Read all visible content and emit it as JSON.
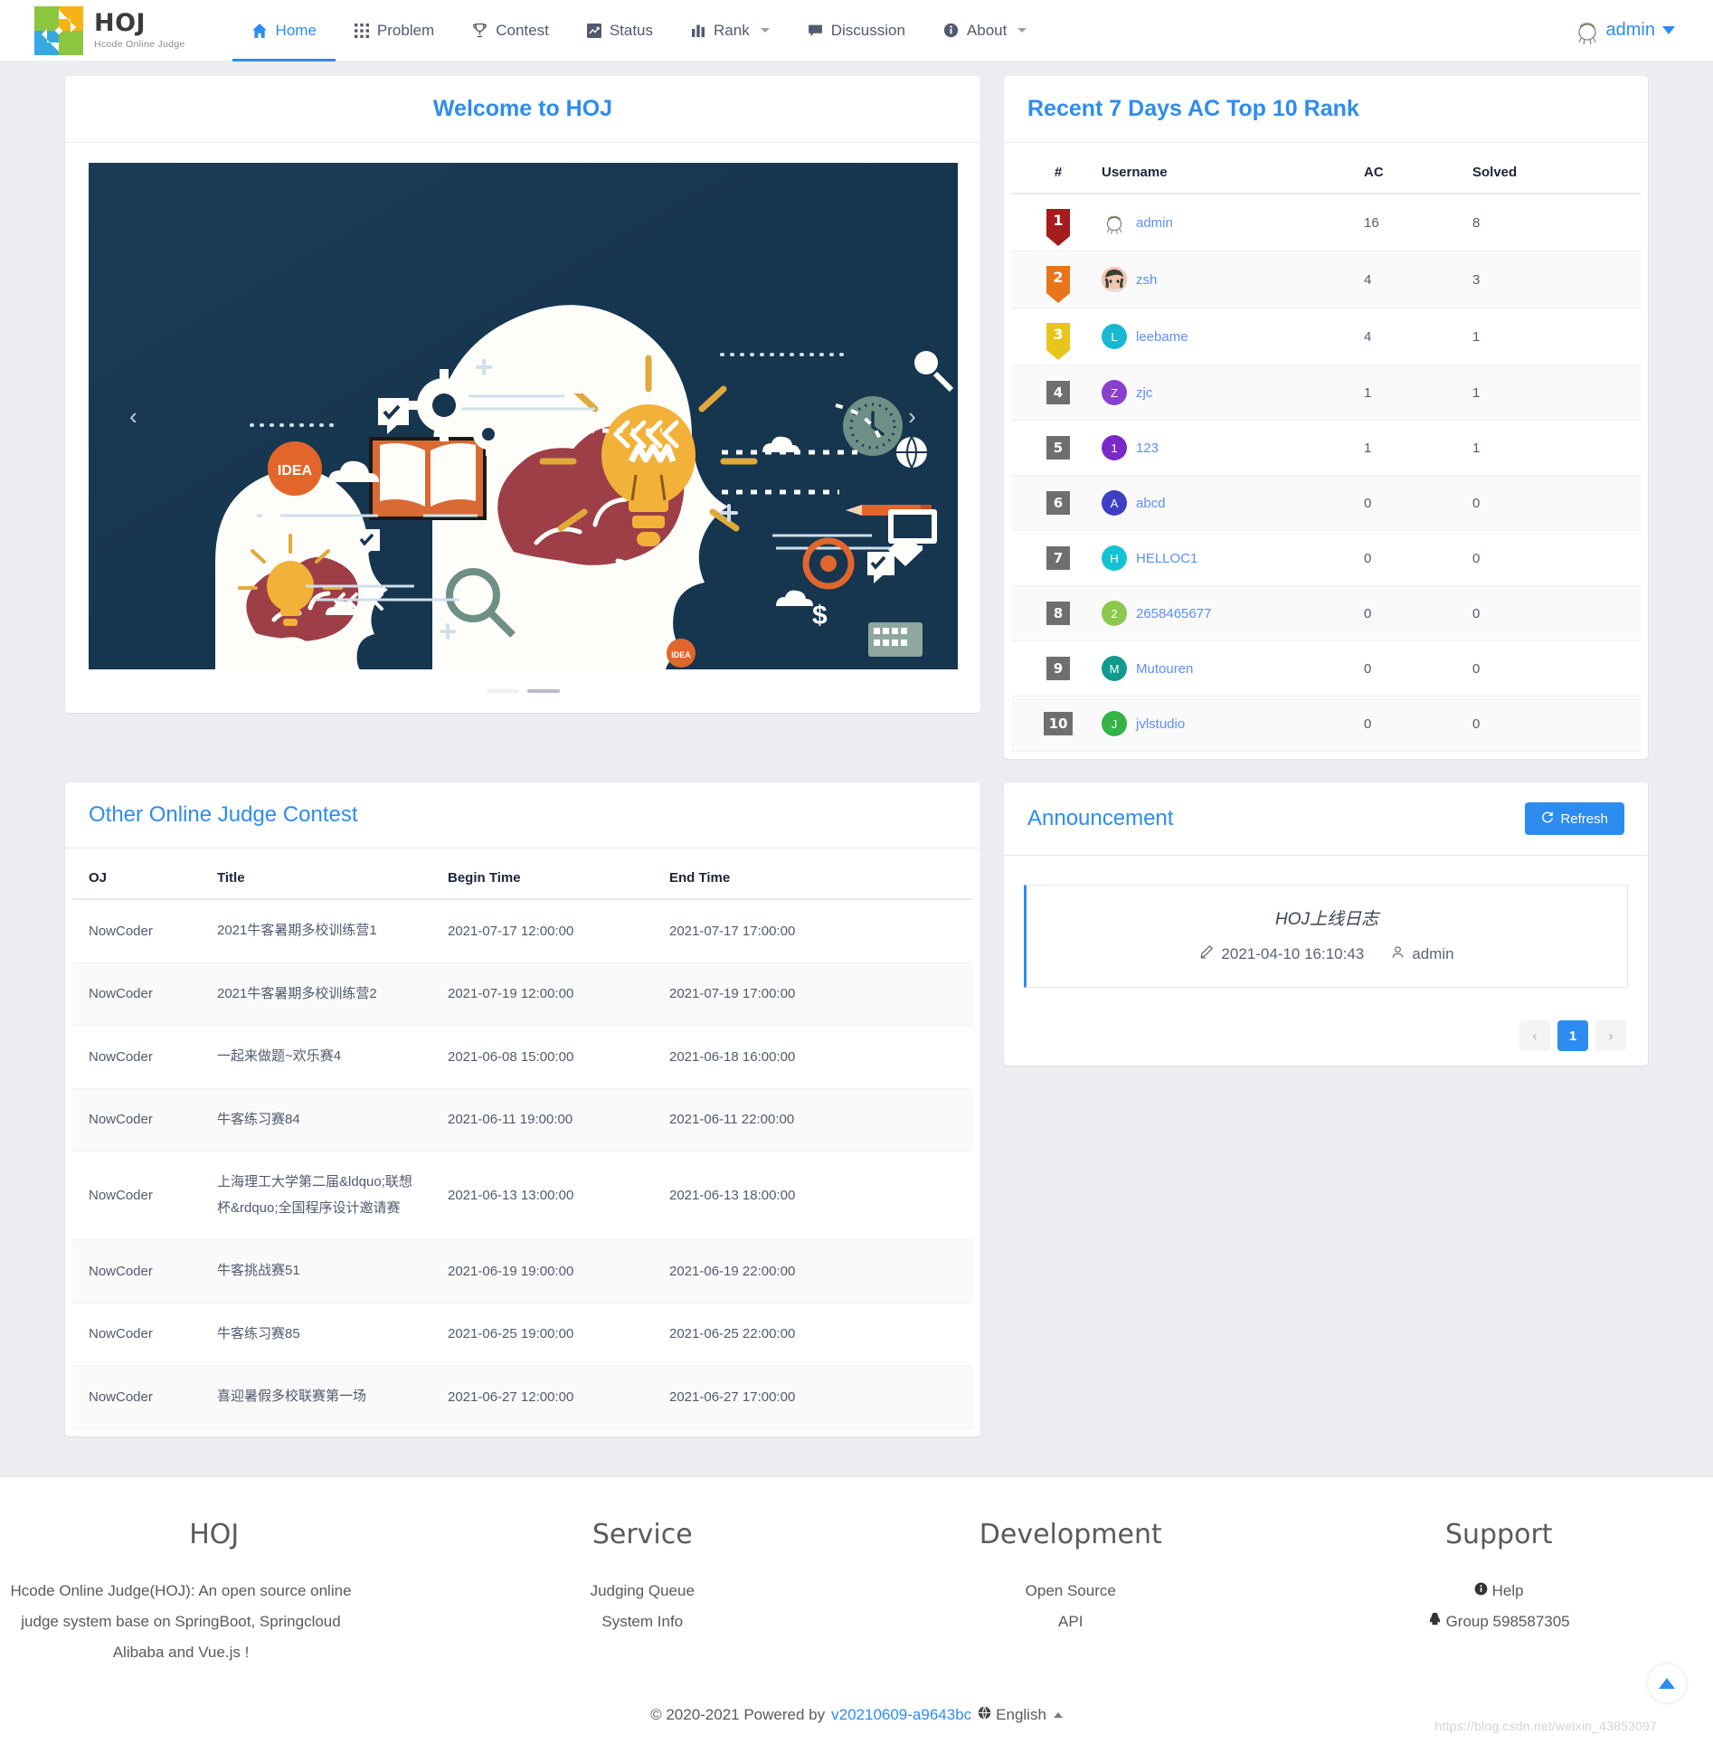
{
  "brand": {
    "title": "HOJ",
    "subtitle": "Hcode Online Judge"
  },
  "nav": {
    "items": [
      {
        "label": "Home",
        "icon": "home-icon",
        "active": true,
        "caret": false
      },
      {
        "label": "Problem",
        "icon": "grid-icon",
        "active": false,
        "caret": false
      },
      {
        "label": "Contest",
        "icon": "trophy-icon",
        "active": false,
        "caret": false
      },
      {
        "label": "Status",
        "icon": "chart-line-icon",
        "active": false,
        "caret": false
      },
      {
        "label": "Rank",
        "icon": "bar-chart-icon",
        "active": false,
        "caret": true
      },
      {
        "label": "Discussion",
        "icon": "comment-icon",
        "active": false,
        "caret": false
      },
      {
        "label": "About",
        "icon": "info-icon",
        "active": false,
        "caret": true
      }
    ],
    "user": "admin"
  },
  "welcome": {
    "title": "Welcome to HOJ",
    "carousel": {
      "prev_icon": "chevron-left-icon",
      "next_icon": "chevron-right-icon",
      "slide_count": 2,
      "active_slide": 2,
      "banner_words": [
        "IDEA",
        "IDEA"
      ]
    }
  },
  "rank_panel": {
    "title": "Recent 7 Days AC Top 10 Rank",
    "columns": [
      "#",
      "Username",
      "AC",
      "Solved"
    ],
    "rows": [
      {
        "rank": "1",
        "username": "admin",
        "ac": "16",
        "solved": "8",
        "avatar_letter": "",
        "avatar_color": "#ffffff",
        "badge": "ribbon",
        "badge_color": "#a61b1b"
      },
      {
        "rank": "2",
        "username": "zsh",
        "ac": "4",
        "solved": "3",
        "avatar_letter": "",
        "avatar_color": "#f3b9a0",
        "badge": "ribbon",
        "badge_color": "#e8751a"
      },
      {
        "rank": "3",
        "username": "leebame",
        "ac": "4",
        "solved": "1",
        "avatar_letter": "L",
        "avatar_color": "#18b8d4",
        "badge": "ribbon",
        "badge_color": "#e8c51a"
      },
      {
        "rank": "4",
        "username": "zjc",
        "ac": "1",
        "solved": "1",
        "avatar_letter": "Z",
        "avatar_color": "#8a3fd1",
        "badge": "plain",
        "badge_color": "#6f6f6f"
      },
      {
        "rank": "5",
        "username": "123",
        "ac": "1",
        "solved": "1",
        "avatar_letter": "1",
        "avatar_color": "#7a29c9",
        "badge": "plain",
        "badge_color": "#6f6f6f"
      },
      {
        "rank": "6",
        "username": "abcd",
        "ac": "0",
        "solved": "0",
        "avatar_letter": "A",
        "avatar_color": "#3c3fc4",
        "badge": "plain",
        "badge_color": "#6f6f6f"
      },
      {
        "rank": "7",
        "username": "HELLOC1",
        "ac": "0",
        "solved": "0",
        "avatar_letter": "H",
        "avatar_color": "#13c2d4",
        "badge": "plain",
        "badge_color": "#6f6f6f"
      },
      {
        "rank": "8",
        "username": "2658465677",
        "ac": "0",
        "solved": "0",
        "avatar_letter": "2",
        "avatar_color": "#8cc84b",
        "badge": "plain",
        "badge_color": "#6f6f6f"
      },
      {
        "rank": "9",
        "username": "Mutouren",
        "ac": "0",
        "solved": "0",
        "avatar_letter": "M",
        "avatar_color": "#0f9b8e",
        "badge": "plain",
        "badge_color": "#6f6f6f"
      },
      {
        "rank": "10",
        "username": "jvlstudio",
        "ac": "0",
        "solved": "0",
        "avatar_letter": "J",
        "avatar_color": "#35b347",
        "badge": "plain",
        "badge_color": "#6f6f6f"
      }
    ]
  },
  "contest_panel": {
    "title": "Other Online Judge Contest",
    "columns": [
      "OJ",
      "Title",
      "Begin Time",
      "End Time"
    ],
    "rows": [
      {
        "oj": "NowCoder",
        "title": "2021牛客暑期多校训练营1",
        "begin": "2021-07-17 12:00:00",
        "end": "2021-07-17 17:00:00"
      },
      {
        "oj": "NowCoder",
        "title": "2021牛客暑期多校训练营2",
        "begin": "2021-07-19 12:00:00",
        "end": "2021-07-19 17:00:00"
      },
      {
        "oj": "NowCoder",
        "title": "一起来做题~欢乐赛4",
        "begin": "2021-06-08 15:00:00",
        "end": "2021-06-18 16:00:00"
      },
      {
        "oj": "NowCoder",
        "title": "牛客练习赛84",
        "begin": "2021-06-11 19:00:00",
        "end": "2021-06-11 22:00:00"
      },
      {
        "oj": "NowCoder",
        "title": "上海理工大学第二届&ldquo;联想杯&rdquo;全国程序设计邀请赛",
        "begin": "2021-06-13 13:00:00",
        "end": "2021-06-13 18:00:00"
      },
      {
        "oj": "NowCoder",
        "title": "牛客挑战赛51",
        "begin": "2021-06-19 19:00:00",
        "end": "2021-06-19 22:00:00"
      },
      {
        "oj": "NowCoder",
        "title": "牛客练习赛85",
        "begin": "2021-06-25 19:00:00",
        "end": "2021-06-25 22:00:00"
      },
      {
        "oj": "NowCoder",
        "title": "喜迎暑假多校联赛第一场",
        "begin": "2021-06-27 12:00:00",
        "end": "2021-06-27 17:00:00"
      }
    ]
  },
  "announcement_panel": {
    "title": "Announcement",
    "refresh_label": "Refresh",
    "refresh_icon": "refresh-icon",
    "item": {
      "title": "HOJ上线日志",
      "date_icon": "pencil-icon",
      "date": "2021-04-10 16:10:43",
      "author_icon": "user-icon",
      "author": "admin"
    },
    "pagination": {
      "prev_icon": "chevron-left-icon",
      "next_icon": "chevron-right-icon",
      "pages": [
        "1"
      ],
      "current": "1"
    }
  },
  "footer": {
    "columns": [
      {
        "heading": "HOJ",
        "description": "Hcode Online Judge(HOJ):  An open source online judge system base on SpringBoot, Springcloud Alibaba and Vue.js !",
        "links": []
      },
      {
        "heading": "Service",
        "description": "",
        "links": [
          {
            "label": "Judging Queue",
            "icon": ""
          },
          {
            "label": "System Info",
            "icon": ""
          }
        ]
      },
      {
        "heading": "Development",
        "description": "",
        "links": [
          {
            "label": "Open Source",
            "icon": ""
          },
          {
            "label": "API",
            "icon": ""
          }
        ]
      },
      {
        "heading": "Support",
        "description": "",
        "links": [
          {
            "label": "Help",
            "icon": "info-circle-icon"
          },
          {
            "label": "Group 598587305",
            "icon": "qq-icon"
          }
        ]
      }
    ],
    "copyright_prefix": "© 2020-2021 Powered by",
    "version": "v20210609-a9643bc",
    "language": "English",
    "language_icon": "globe-icon",
    "back_to_top_icon": "triangle-up-icon",
    "watermark": "https://blog.csdn.net/weixin_43853097"
  },
  "colors": {
    "accent": "#2d8cf0",
    "link": "#5b8ff9",
    "page_bg": "#eceef1"
  }
}
